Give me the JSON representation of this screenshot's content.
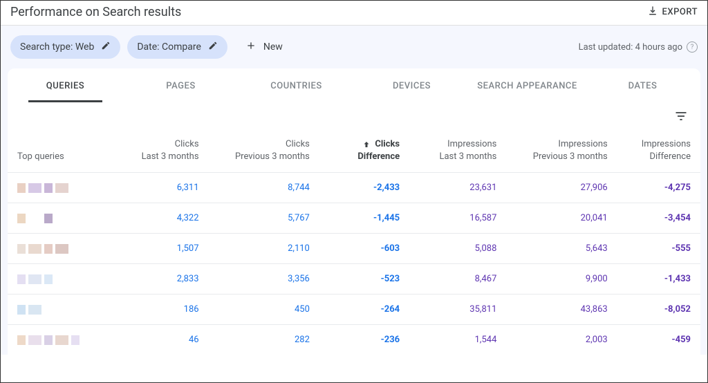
{
  "header": {
    "title": "Performance on Search results",
    "export_label": "EXPORT"
  },
  "filters": {
    "search_type_label": "Search type: Web",
    "date_label": "Date: Compare",
    "new_label": "New",
    "last_updated": "Last updated: 4 hours ago"
  },
  "tabs": [
    {
      "label": "QUERIES",
      "active": true
    },
    {
      "label": "PAGES",
      "active": false
    },
    {
      "label": "COUNTRIES",
      "active": false
    },
    {
      "label": "DEVICES",
      "active": false
    },
    {
      "label": "SEARCH APPEARANCE",
      "active": false
    },
    {
      "label": "DATES",
      "active": false
    }
  ],
  "columns": {
    "c0": {
      "l1": "Top queries"
    },
    "c1": {
      "l1": "Clicks",
      "l2": "Last 3 months"
    },
    "c2": {
      "l1": "Clicks",
      "l2": "Previous 3 months"
    },
    "c3": {
      "l1": "Clicks",
      "l2": "Difference",
      "sorted": "asc"
    },
    "c4": {
      "l1": "Impressions",
      "l2": "Last 3 months"
    },
    "c5": {
      "l1": "Impressions",
      "l2": "Previous 3 months"
    },
    "c6": {
      "l1": "Impressions",
      "l2": "Difference"
    }
  },
  "rows": [
    {
      "clicks_last": "6,311",
      "clicks_prev": "8,744",
      "clicks_diff": "-2,433",
      "impr_last": "23,631",
      "impr_prev": "27,906",
      "impr_diff": "-4,275"
    },
    {
      "clicks_last": "4,322",
      "clicks_prev": "5,767",
      "clicks_diff": "-1,445",
      "impr_last": "16,587",
      "impr_prev": "20,041",
      "impr_diff": "-3,454"
    },
    {
      "clicks_last": "1,507",
      "clicks_prev": "2,110",
      "clicks_diff": "-603",
      "impr_last": "5,088",
      "impr_prev": "5,643",
      "impr_diff": "-555"
    },
    {
      "clicks_last": "2,833",
      "clicks_prev": "3,356",
      "clicks_diff": "-523",
      "impr_last": "8,467",
      "impr_prev": "9,900",
      "impr_diff": "-1,433"
    },
    {
      "clicks_last": "186",
      "clicks_prev": "450",
      "clicks_diff": "-264",
      "impr_last": "35,811",
      "impr_prev": "43,863",
      "impr_diff": "-8,052"
    },
    {
      "clicks_last": "46",
      "clicks_prev": "282",
      "clicks_diff": "-236",
      "impr_last": "1,544",
      "impr_prev": "2,003",
      "impr_diff": "-459"
    }
  ],
  "blur_palettes": [
    [
      "#e9d0c3",
      "#d7c9e6",
      "#c9b6d8",
      "#e5d3cf"
    ],
    [
      "#ecd7c2",
      "#ffffff",
      "#b9a9c9",
      "#ffffff"
    ],
    [
      "#eadfd7",
      "#e9d9cf",
      "#e5ccc4",
      "#dcc7c2"
    ],
    [
      "#e4dff2",
      "#e0e6f3",
      "#dbe8f6",
      "#ffffff"
    ],
    [
      "#cfe2f3",
      "#d9e6f2",
      "#ffffff",
      "#ffffff"
    ],
    [
      "#eed9c8",
      "#e9dfec",
      "#d9d0e6",
      "#e8d7cf",
      "#e6dff2"
    ]
  ]
}
